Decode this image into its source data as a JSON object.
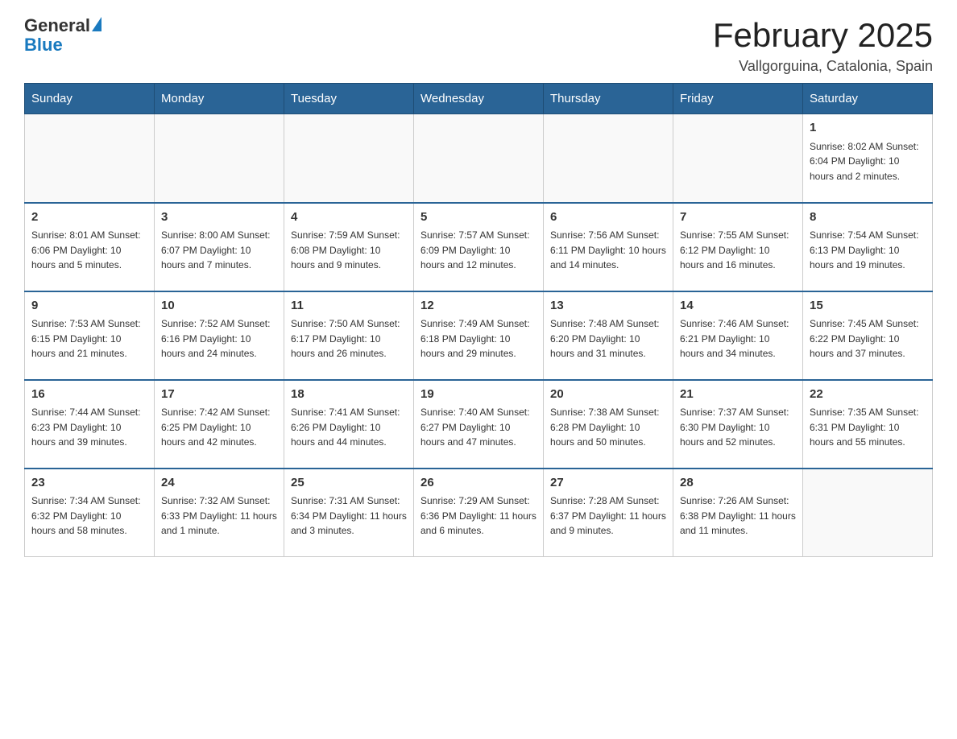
{
  "logo": {
    "general": "General",
    "blue": "Blue",
    "tagline": ""
  },
  "header": {
    "month_year": "February 2025",
    "location": "Vallgorguina, Catalonia, Spain"
  },
  "days_of_week": [
    "Sunday",
    "Monday",
    "Tuesday",
    "Wednesday",
    "Thursday",
    "Friday",
    "Saturday"
  ],
  "weeks": [
    {
      "days": [
        {
          "num": "",
          "info": ""
        },
        {
          "num": "",
          "info": ""
        },
        {
          "num": "",
          "info": ""
        },
        {
          "num": "",
          "info": ""
        },
        {
          "num": "",
          "info": ""
        },
        {
          "num": "",
          "info": ""
        },
        {
          "num": "1",
          "info": "Sunrise: 8:02 AM\nSunset: 6:04 PM\nDaylight: 10 hours and 2 minutes."
        }
      ]
    },
    {
      "days": [
        {
          "num": "2",
          "info": "Sunrise: 8:01 AM\nSunset: 6:06 PM\nDaylight: 10 hours and 5 minutes."
        },
        {
          "num": "3",
          "info": "Sunrise: 8:00 AM\nSunset: 6:07 PM\nDaylight: 10 hours and 7 minutes."
        },
        {
          "num": "4",
          "info": "Sunrise: 7:59 AM\nSunset: 6:08 PM\nDaylight: 10 hours and 9 minutes."
        },
        {
          "num": "5",
          "info": "Sunrise: 7:57 AM\nSunset: 6:09 PM\nDaylight: 10 hours and 12 minutes."
        },
        {
          "num": "6",
          "info": "Sunrise: 7:56 AM\nSunset: 6:11 PM\nDaylight: 10 hours and 14 minutes."
        },
        {
          "num": "7",
          "info": "Sunrise: 7:55 AM\nSunset: 6:12 PM\nDaylight: 10 hours and 16 minutes."
        },
        {
          "num": "8",
          "info": "Sunrise: 7:54 AM\nSunset: 6:13 PM\nDaylight: 10 hours and 19 minutes."
        }
      ]
    },
    {
      "days": [
        {
          "num": "9",
          "info": "Sunrise: 7:53 AM\nSunset: 6:15 PM\nDaylight: 10 hours and 21 minutes."
        },
        {
          "num": "10",
          "info": "Sunrise: 7:52 AM\nSunset: 6:16 PM\nDaylight: 10 hours and 24 minutes."
        },
        {
          "num": "11",
          "info": "Sunrise: 7:50 AM\nSunset: 6:17 PM\nDaylight: 10 hours and 26 minutes."
        },
        {
          "num": "12",
          "info": "Sunrise: 7:49 AM\nSunset: 6:18 PM\nDaylight: 10 hours and 29 minutes."
        },
        {
          "num": "13",
          "info": "Sunrise: 7:48 AM\nSunset: 6:20 PM\nDaylight: 10 hours and 31 minutes."
        },
        {
          "num": "14",
          "info": "Sunrise: 7:46 AM\nSunset: 6:21 PM\nDaylight: 10 hours and 34 minutes."
        },
        {
          "num": "15",
          "info": "Sunrise: 7:45 AM\nSunset: 6:22 PM\nDaylight: 10 hours and 37 minutes."
        }
      ]
    },
    {
      "days": [
        {
          "num": "16",
          "info": "Sunrise: 7:44 AM\nSunset: 6:23 PM\nDaylight: 10 hours and 39 minutes."
        },
        {
          "num": "17",
          "info": "Sunrise: 7:42 AM\nSunset: 6:25 PM\nDaylight: 10 hours and 42 minutes."
        },
        {
          "num": "18",
          "info": "Sunrise: 7:41 AM\nSunset: 6:26 PM\nDaylight: 10 hours and 44 minutes."
        },
        {
          "num": "19",
          "info": "Sunrise: 7:40 AM\nSunset: 6:27 PM\nDaylight: 10 hours and 47 minutes."
        },
        {
          "num": "20",
          "info": "Sunrise: 7:38 AM\nSunset: 6:28 PM\nDaylight: 10 hours and 50 minutes."
        },
        {
          "num": "21",
          "info": "Sunrise: 7:37 AM\nSunset: 6:30 PM\nDaylight: 10 hours and 52 minutes."
        },
        {
          "num": "22",
          "info": "Sunrise: 7:35 AM\nSunset: 6:31 PM\nDaylight: 10 hours and 55 minutes."
        }
      ]
    },
    {
      "days": [
        {
          "num": "23",
          "info": "Sunrise: 7:34 AM\nSunset: 6:32 PM\nDaylight: 10 hours and 58 minutes."
        },
        {
          "num": "24",
          "info": "Sunrise: 7:32 AM\nSunset: 6:33 PM\nDaylight: 11 hours and 1 minute."
        },
        {
          "num": "25",
          "info": "Sunrise: 7:31 AM\nSunset: 6:34 PM\nDaylight: 11 hours and 3 minutes."
        },
        {
          "num": "26",
          "info": "Sunrise: 7:29 AM\nSunset: 6:36 PM\nDaylight: 11 hours and 6 minutes."
        },
        {
          "num": "27",
          "info": "Sunrise: 7:28 AM\nSunset: 6:37 PM\nDaylight: 11 hours and 9 minutes."
        },
        {
          "num": "28",
          "info": "Sunrise: 7:26 AM\nSunset: 6:38 PM\nDaylight: 11 hours and 11 minutes."
        },
        {
          "num": "",
          "info": ""
        }
      ]
    }
  ]
}
